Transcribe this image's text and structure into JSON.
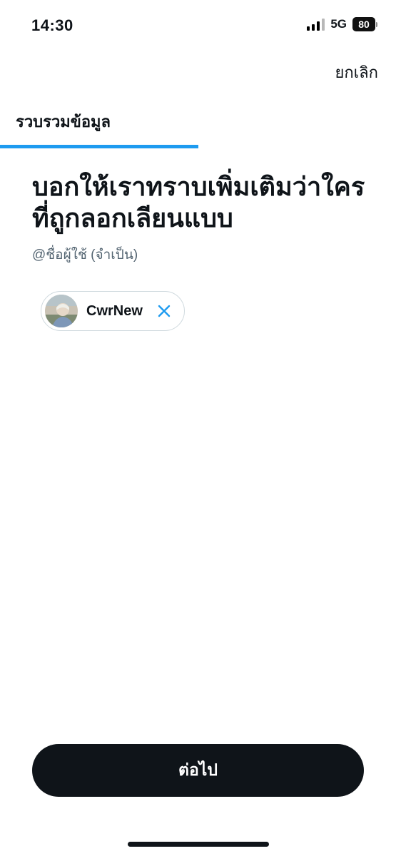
{
  "status_bar": {
    "time": "14:30",
    "network": "5G",
    "battery": "80"
  },
  "header": {
    "cancel_label": "ยกเลิก"
  },
  "step": {
    "title": "รวบรวมข้อมูล",
    "progress": 0.5
  },
  "main": {
    "heading": "บอกให้เราทราบเพิ่มเติมว่าใครที่ถูกลอกเลียนแบบ",
    "subtext": "@ชื่อผู้ใช้ (จำเป็น)",
    "selected_user": {
      "name": "CwrNew",
      "remove_icon": "close-icon"
    }
  },
  "footer": {
    "next_label": "ต่อไป"
  },
  "colors": {
    "accent": "#1d9bf0",
    "primary_button": "#0f1419",
    "secondary_text": "#536471"
  }
}
